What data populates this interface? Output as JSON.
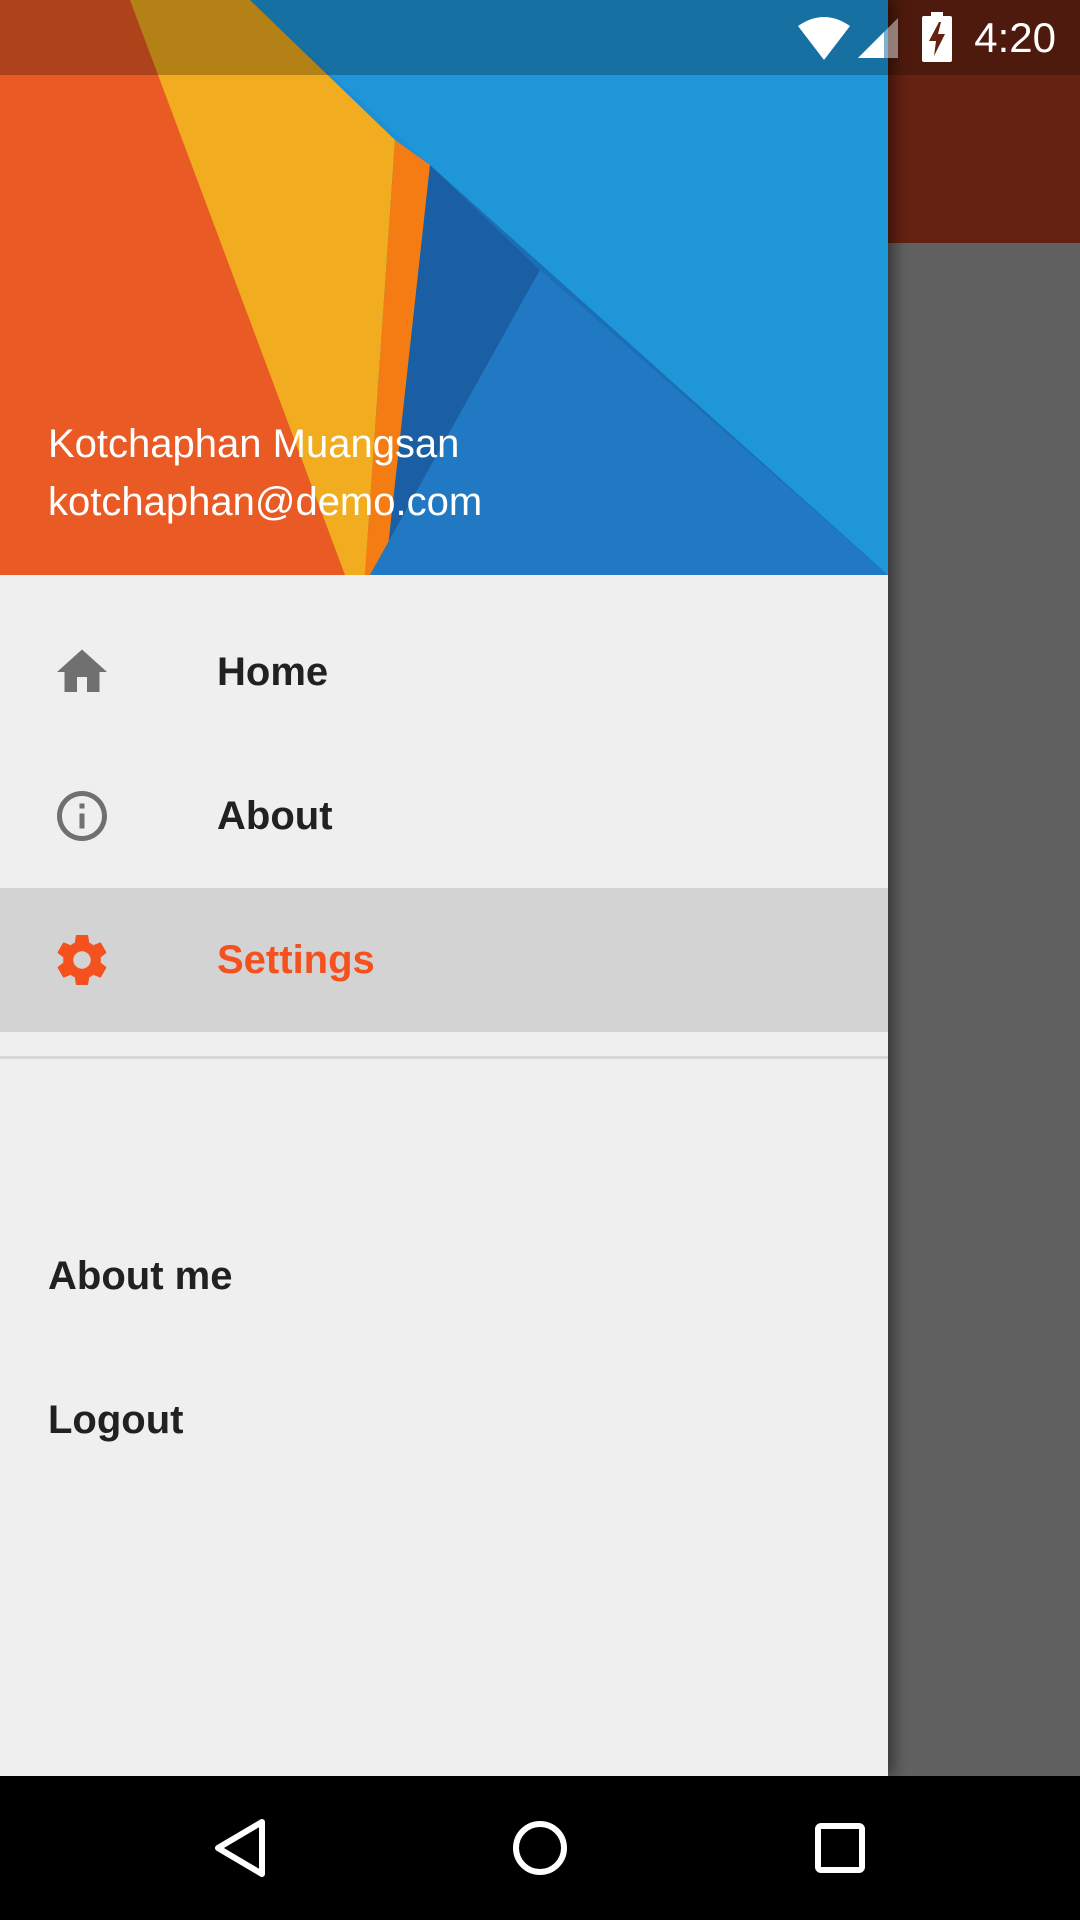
{
  "status_bar": {
    "time": "4:20",
    "icons": [
      "wifi-icon",
      "signal-icon",
      "battery-charging-icon"
    ]
  },
  "drawer": {
    "header": {
      "name": "Kotchaphan Muangsan",
      "email": "kotchaphan@demo.com"
    },
    "menu": [
      {
        "label": "Home",
        "icon": "home-icon",
        "selected": false
      },
      {
        "label": "About",
        "icon": "info-icon",
        "selected": false
      },
      {
        "label": "Settings",
        "icon": "gear-icon",
        "selected": true
      }
    ],
    "secondary": [
      {
        "label": "About me"
      },
      {
        "label": "Logout"
      }
    ]
  },
  "colors": {
    "accent": "#f4511e",
    "selected_bg": "#d3d3d3",
    "drawer_bg": "#efefef",
    "toolbar_dark": "#652211"
  },
  "nav_bar": {
    "buttons": [
      "back-icon",
      "home-circle-icon",
      "recents-icon"
    ]
  }
}
